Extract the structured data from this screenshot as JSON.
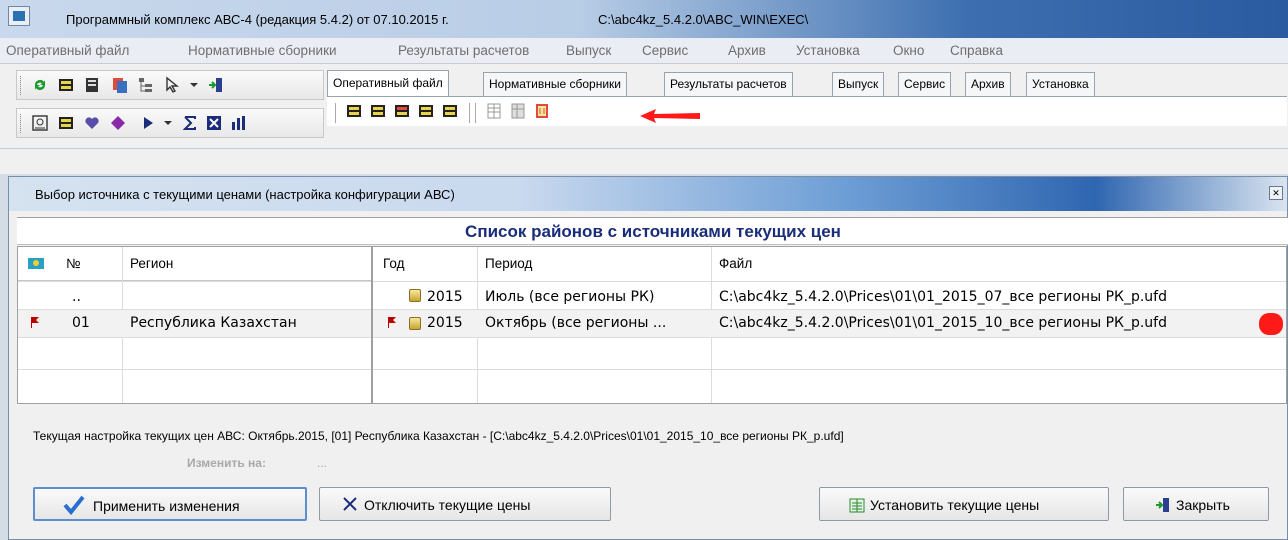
{
  "window": {
    "title": "Программный комплекс АВС-4 (редакция 5.4.2)  от 07.10.2015 г.",
    "path": "C:\\abc4kz_5.4.2.0\\ABC_WIN\\EXEC\\"
  },
  "menu": [
    "Оперативный файл",
    "Нормативные сборники",
    "Результаты расчетов",
    "Выпуск",
    "Сервис",
    "Архив",
    "Установка",
    "Окно",
    "Справка"
  ],
  "tabs": [
    "Оперативный файл",
    "Нормативные сборники",
    "Результаты расчетов",
    "Выпуск",
    "Сервис",
    "Архив",
    "Установка"
  ],
  "dialog": {
    "title": "Выбор источника с текущими ценами (настройка конфигурации АВС)",
    "header": "Список районов с источниками текущих цен",
    "left_columns": [
      "№",
      "Регион"
    ],
    "left_rows": [
      {
        "num": "..",
        "region": ""
      },
      {
        "num": "01",
        "region": "Республика Казахстан"
      }
    ],
    "right_columns": [
      "Год",
      "Период",
      "Файл"
    ],
    "right_rows": [
      {
        "year": "2015",
        "period": "Июль (все регионы РК)",
        "file": "C:\\abc4kz_5.4.2.0\\Prices\\01\\01_2015_07_все регионы РК_p.ufd"
      },
      {
        "year": "2015",
        "period": "Октябрь (все регионы ...",
        "file": "C:\\abc4kz_5.4.2.0\\Prices\\01\\01_2015_10_все регионы РК_p.ufd"
      }
    ],
    "status": "Текущая настройка текущих цен АВС: Октябрь.2015, [01] Республика Казахстан - [C:\\abc4kz_5.4.2.0\\Prices\\01\\01_2015_10_все регионы РК_p.ufd]",
    "change_label": "Изменить на:",
    "change_value": "...",
    "buttons": {
      "apply": "Применить изменения",
      "disable": "Отключить текущие цены",
      "install": "Установить текущие цены",
      "close": "Закрыть"
    }
  },
  "colors": {
    "accent": "#1a2d7a",
    "annotation": "#ff1a1a",
    "titlebar_dark": "#2a5aa0"
  }
}
